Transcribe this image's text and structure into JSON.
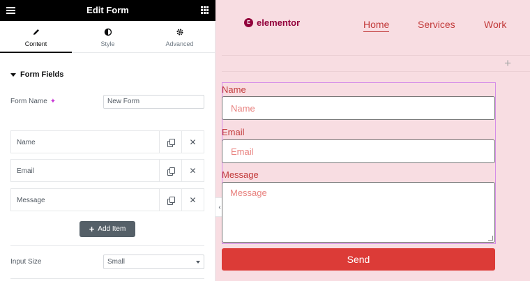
{
  "editor": {
    "title": "Edit Form",
    "tabs": [
      {
        "label": "Content",
        "icon": "pencil-icon"
      },
      {
        "label": "Style",
        "icon": "half-circle-icon"
      },
      {
        "label": "Advanced",
        "icon": "gear-icon"
      }
    ],
    "section_title": "Form Fields",
    "form_name_label": "Form Name",
    "form_name_value": "New Form",
    "fields": [
      {
        "label": "Name"
      },
      {
        "label": "Email"
      },
      {
        "label": "Message"
      }
    ],
    "add_item_label": "Add Item",
    "input_size_label": "Input Size",
    "input_size_value": "Small"
  },
  "preview": {
    "logo_text": "elementor",
    "nav": [
      {
        "label": "Home",
        "active": true
      },
      {
        "label": "Services",
        "active": false
      },
      {
        "label": "Work",
        "active": false
      }
    ],
    "form": {
      "name_label": "Name",
      "name_placeholder": "Name",
      "email_label": "Email",
      "email_placeholder": "Email",
      "message_label": "Message",
      "message_placeholder": "Message",
      "submit_label": "Send"
    }
  },
  "colors": {
    "editor_topbar": "#000000",
    "preview_bg": "#f8dde2",
    "accent_red": "#c23a3a",
    "button_red": "#dc3b37",
    "brand": "#92003b"
  }
}
